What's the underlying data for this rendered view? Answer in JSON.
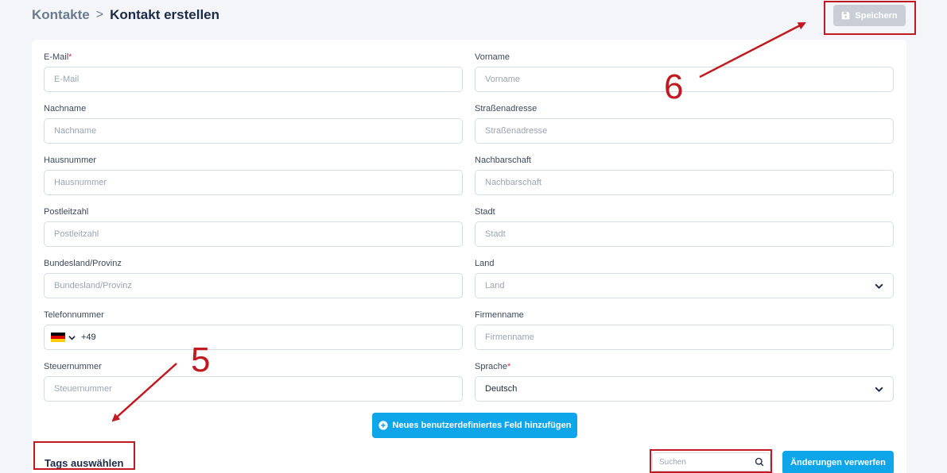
{
  "breadcrumb": {
    "root": "Kontakte",
    "separator": ">",
    "current": "Kontakt erstellen"
  },
  "toolbar": {
    "save_label": "Speichern"
  },
  "form": {
    "email": {
      "label": "E-Mail",
      "required": "*",
      "placeholder": "E-Mail"
    },
    "vorname": {
      "label": "Vorname",
      "placeholder": "Vorname"
    },
    "nachname": {
      "label": "Nachname",
      "placeholder": "Nachname"
    },
    "strasse": {
      "label": "Straßenadresse",
      "placeholder": "Straßenadresse"
    },
    "hausnummer": {
      "label": "Hausnummer",
      "placeholder": "Hausnummer"
    },
    "nachbarschaft": {
      "label": "Nachbarschaft",
      "placeholder": "Nachbarschaft"
    },
    "plz": {
      "label": "Postleitzahl",
      "placeholder": "Postleitzahl"
    },
    "stadt": {
      "label": "Stadt",
      "placeholder": "Stadt"
    },
    "bundesland": {
      "label": "Bundesland/Provinz",
      "placeholder": "Bundesland/Provinz"
    },
    "land": {
      "label": "Land",
      "placeholder": "Land"
    },
    "telefon": {
      "label": "Telefonnummer",
      "country_code": "+49"
    },
    "firmenname": {
      "label": "Firmenname",
      "placeholder": "Firmenname"
    },
    "steuernummer": {
      "label": "Steuernummer",
      "placeholder": "Steuernummer"
    },
    "sprache": {
      "label": "Sprache",
      "required": "*",
      "value": "Deutsch"
    }
  },
  "add_field_label": "Neues benutzerdefiniertes Feld hinzufügen",
  "tags": {
    "title": "Tags auswählen",
    "search_placeholder": "Suchen",
    "discard_label": "Änderungen verwerfen"
  },
  "annotations": {
    "five": "5",
    "six": "6"
  },
  "colors": {
    "accent": "#0ea5e9",
    "annotation": "#c0191f",
    "disabled": "#c9ced6",
    "required": "#e0334c"
  },
  "icons": {
    "save": "floppy-disk-icon",
    "add": "plus-circle-icon",
    "search": "search-icon",
    "dropdown": "chevron-down-icon",
    "flag": "germany-flag-icon"
  }
}
